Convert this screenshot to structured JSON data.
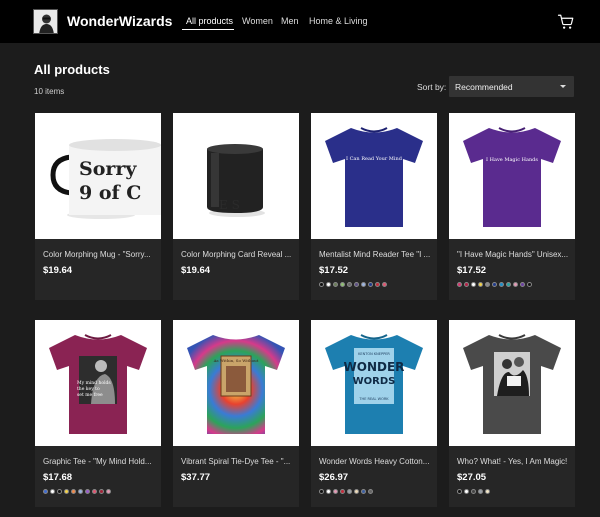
{
  "header": {
    "brand": "WonderWizards",
    "nav": [
      "All products",
      "Women",
      "Men",
      "Home & Living"
    ],
    "active_nav": "All products",
    "cart_icon": "shopping-cart-icon"
  },
  "main": {
    "title": "All products",
    "count": "10 items",
    "sort_label": "Sort by:",
    "sort_value": "Recommended"
  },
  "products": [
    {
      "title": "Color Morphing Mug - \"Sorry...",
      "price": "$19.64",
      "swatches": []
    },
    {
      "title": "Color Morphing Card Reveal ...",
      "price": "$19.64",
      "swatches": []
    },
    {
      "title": "Mentalist Mind Reader Tee \"I ...",
      "price": "$17.52",
      "swatches": [
        "#111111",
        "#ffffff",
        "#6b7d5a",
        "#8fbf73",
        "#666666",
        "#5c4f84",
        "#9db4e0",
        "#1f3a8a",
        "#c22b3b",
        "#e05570"
      ]
    },
    {
      "title": "\"I Have Magic Hands\" Unisex...",
      "price": "$17.52",
      "swatches": [
        "#d6366f",
        "#b22045",
        "#ffffff",
        "#f2d14a",
        "#888888",
        "#1f3a8a",
        "#1c8ec9",
        "#27a0a0",
        "#e39ab5",
        "#6a3fa0",
        "#111111"
      ]
    },
    {
      "title": "Graphic Tee - \"My Mind Hold...",
      "price": "$17.68",
      "swatches": [
        "#3f6bd0",
        "#ffffff",
        "#111111",
        "#f2d14a",
        "#f08a4b",
        "#9db4e0",
        "#9a5dc9",
        "#e05570",
        "#a02338",
        "#e39ab5"
      ]
    },
    {
      "title": "Vibrant Spiral Tie-Dye Tee - \"...",
      "price": "$37.77",
      "swatches": []
    },
    {
      "title": "Wonder Words Heavy Cotton...",
      "price": "$26.97",
      "swatches": [
        "#111111",
        "#ffffff",
        "#e39ab5",
        "#c22b3b",
        "#9aa0a8",
        "#ead8b8",
        "#3b5ea0",
        "#666666"
      ]
    },
    {
      "title": "Who? What! - Yes, I Am Magic!",
      "price": "$27.05",
      "swatches": [
        "#111111",
        "#ffffff",
        "#444444",
        "#9aa0a8",
        "#f2e6c8"
      ]
    }
  ],
  "product_art": {
    "mug1_text": [
      "Sorry",
      "9 of C"
    ],
    "tee_blue_text": "I Can Read Your Mind",
    "tee_purple_text": "I Have Magic Hands",
    "tee_maroon_text": [
      "My mind holds",
      "the key to",
      "set me free"
    ],
    "tee_tiedye_text": "As Within, So Without",
    "tee_wonder_text": [
      "KENTON KNEPPER",
      "WONDER",
      "WORDS",
      "THE REAL WORK"
    ]
  }
}
